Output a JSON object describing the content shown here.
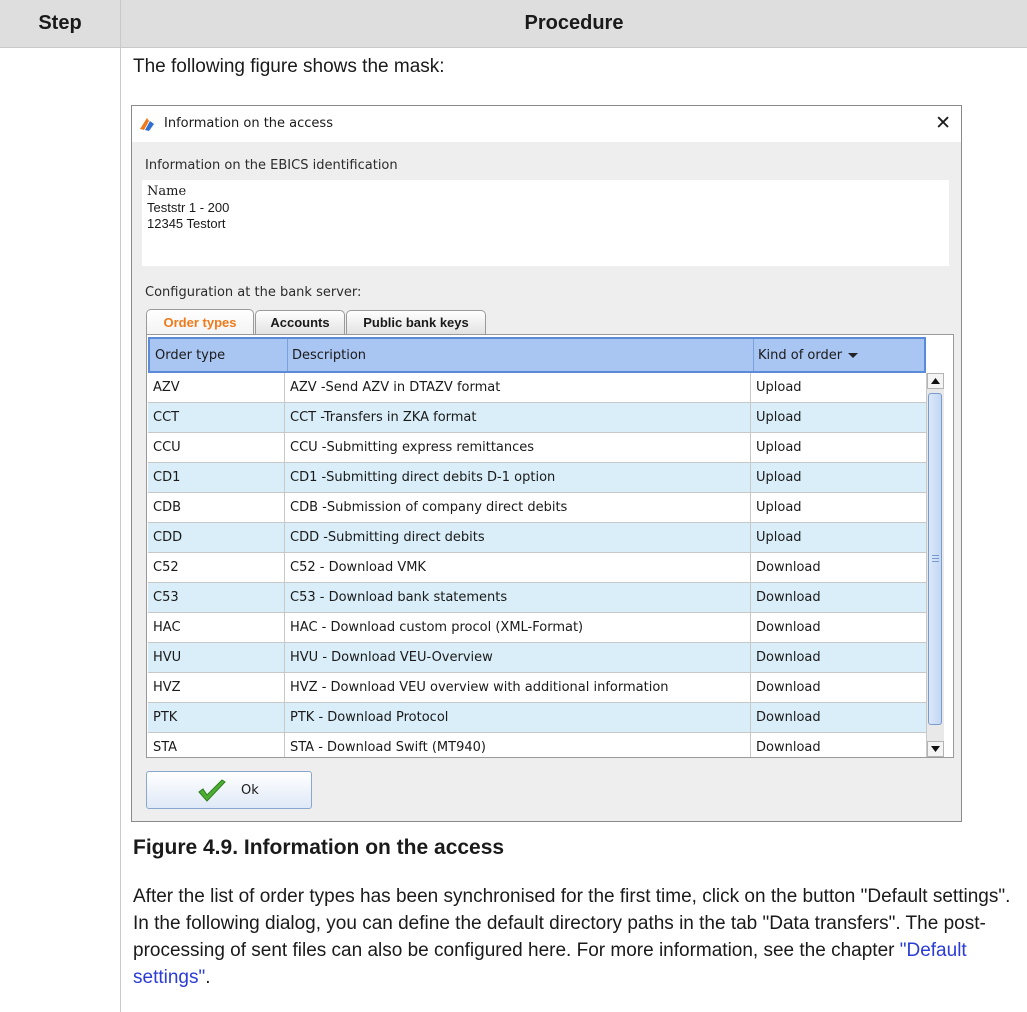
{
  "header": {
    "step": "Step",
    "procedure": "Procedure"
  },
  "intro_text": "The following figure shows the mask:",
  "dialog": {
    "title": "Information on the access",
    "close_icon": "close-icon",
    "ebics_label": "Information on the EBICS identification",
    "info_name": "Name",
    "info_street": "Teststr 1 - 200",
    "info_city": "12345 Testort",
    "bank_config_label": "Configuration at the bank server:",
    "tabs": [
      {
        "label": "Order types",
        "active": true
      },
      {
        "label": "Accounts",
        "active": false
      },
      {
        "label": "Public bank keys",
        "active": false
      }
    ],
    "columns": {
      "order_type": "Order type",
      "description": "Description",
      "kind": "Kind of order"
    },
    "rows": [
      {
        "type": "AZV",
        "desc": "AZV -Send AZV in DTAZV format",
        "kind": "Upload"
      },
      {
        "type": "CCT",
        "desc": "CCT -Transfers in ZKA format",
        "kind": "Upload"
      },
      {
        "type": "CCU",
        "desc": "CCU -Submitting express remittances",
        "kind": "Upload"
      },
      {
        "type": "CD1",
        "desc": "CD1 -Submitting direct debits D-1 option",
        "kind": "Upload"
      },
      {
        "type": "CDB",
        "desc": "CDB -Submission of company direct debits",
        "kind": "Upload"
      },
      {
        "type": "CDD",
        "desc": "CDD -Submitting direct debits",
        "kind": "Upload"
      },
      {
        "type": "C52",
        "desc": "C52 -   Download VMK",
        "kind": "Download"
      },
      {
        "type": "C53",
        "desc": "C53 -   Download bank statements",
        "kind": "Download"
      },
      {
        "type": "HAC",
        "desc": "HAC -   Download custom procol (XML-Format)",
        "kind": "Download"
      },
      {
        "type": "HVU",
        "desc": "HVU -   Download VEU-Overview",
        "kind": "Download"
      },
      {
        "type": "HVZ",
        "desc": "HVZ -   Download VEU overview with additional information",
        "kind": "Download"
      },
      {
        "type": "PTK",
        "desc": "PTK -   Download Protocol",
        "kind": "Download"
      },
      {
        "type": "STA",
        "desc": "STA -   Download Swift (MT940)",
        "kind": "Download"
      }
    ],
    "ok_label": "Ok"
  },
  "figure_caption": "Figure 4.9. Information on the access",
  "paragraph": {
    "text": "After the list of order types has been synchronised for the first time, click on the button \"Default settings\". In the following dialog, you can define the default directory paths in the tab \"Data transfers\". The post-processing of sent files can also be configured here. For more information, see the chapter ",
    "link": "\"Default settings\"",
    "end": "."
  },
  "colors": {
    "active_tab": "#f07a1a",
    "header_bg": "#a9c5f2",
    "alt_row": "#d9eef8",
    "link": "#2a3bd6"
  }
}
